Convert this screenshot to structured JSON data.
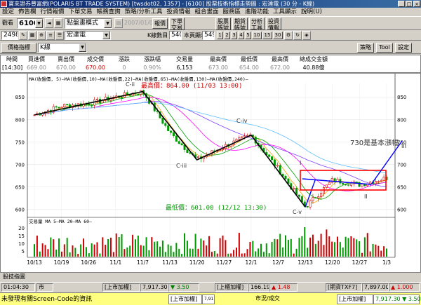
{
  "window": {
    "title": "寶來證券豐富網(POLARIS BT TRADE SYSTEM) [twsdot02, 1357] - [6100] 股票技術指標走勢圖 : 宏達電 (30 分 - K線)",
    "buttons": [
      "_",
      "□",
      "×"
    ]
  },
  "menu": [
    "設定",
    "佈告欄",
    "行情報價",
    "下單交易",
    "帳務查詢",
    "策略/分析工具",
    "投資情報",
    "組合畫面",
    "服務區",
    "進階功能",
    "工具顯示",
    "說明(U)"
  ],
  "toolbar1": {
    "view_label": "觀看",
    "stock_code": "6100",
    "mode_value": "點盤畫模式",
    "quote_button": "報價",
    "date_value": "2007/01/03",
    "k_count_label": "K線數目",
    "k_count": "540",
    "display_label": "本頁顯示",
    "display_count": "549",
    "order_button_1": "下單",
    "order_button_2": "交易",
    "service_button_1": "股票",
    "service_button_2": "帳號",
    "service_button_3": "期貨",
    "service_button_4": "帳號",
    "tool_button_1": "分析",
    "tool_button_2": "工具",
    "info_button_1": "投資",
    "info_button_2": "情報"
  },
  "toolbar2": {
    "code": "2498",
    "stock_name": "宏達電",
    "page_buttons": [
      "1",
      "2",
      "3",
      "4",
      "5",
      "10",
      "15",
      "30"
    ],
    "right_button_1": "策略",
    "right_button_2": "Tool",
    "right_button_3": "設定"
  },
  "toolbar3": {
    "indicator_button": "價格指標",
    "indicator_value": "K線"
  },
  "quote": {
    "headers": [
      "時間",
      "買進價",
      "賣出價",
      "成交價",
      "漲跌",
      "漲跌幅",
      "交易量",
      "最高價",
      "最低價",
      "最高價",
      "總成交金額"
    ],
    "values": [
      "[14:30]",
      "669.00",
      "670.00",
      "670.00",
      "0",
      "0.90%",
      "6,153",
      "673.00",
      "654.00",
      "672.00",
      "40.88億"
    ]
  },
  "chart": {
    "ma_legend": "MA(收盤價, 5)—MA(收盤價,10)—MA(收盤價,22)—MA(收盤價,65)—MA(收盤價,130)—MA(收盤價,240)—",
    "high_label": "最高價：864.00 (11/03 13:00)",
    "low_label": "最低價：601.00 (12/12 13:30)",
    "wave_labels": {
      "c_ii": "C-ii",
      "c_iii": "C-iii",
      "c_iv": "C-iv",
      "c_v": "C-v",
      "one": "I",
      "two": "II",
      "three": "III"
    },
    "annotation": "730是基本漲幅",
    "price_axis": [
      "850",
      "800",
      "750",
      "700",
      "650",
      "600"
    ],
    "volume_legend": "交易量 MA 5—MA 20—MA 60—",
    "volume_axis": [
      "20",
      "15",
      "10",
      "5"
    ],
    "date_axis": [
      "10/13",
      "10/19",
      "10/26",
      "11/1",
      "11/7",
      "11/13",
      "11/20",
      "11/27",
      "12/1",
      "12/7",
      "12/13",
      "12/20",
      "12/27",
      "1/3"
    ],
    "colors": {
      "up": "#cc0000",
      "down": "#009900",
      "ma5": "#ffa000",
      "ma10": "#00a000",
      "ma22": "#ff00ff",
      "ma65": "#8040ff",
      "ma130": "#60c0ff",
      "ma240": "#c0c0c0",
      "wave": "#000000",
      "box": "#ff0000",
      "trend": "#0000ff",
      "label_red": "#cc0000",
      "label_green": "#009900"
    }
  },
  "chart_data": {
    "type": "line",
    "title": "",
    "x": [
      "10/13",
      "10/19",
      "10/26",
      "11/1",
      "11/7",
      "11/13",
      "11/20",
      "11/27",
      "12/1",
      "12/7",
      "12/13",
      "12/20",
      "12/27",
      "1/3"
    ],
    "series": [
      {
        "name": "",
        "values": [
          810,
          830,
          835,
          850,
          862,
          770,
          710,
          740,
          765,
          690,
          605,
          665,
          655,
          670
        ]
      }
    ],
    "ylim": [
      590,
      880
    ]
  },
  "bottom": {
    "label": "股技指圖"
  },
  "status": {
    "time": "01:04:30",
    "market": "市",
    "index1_label": "[上市加權]",
    "index1_value": "7,917.30",
    "index1_change": "▼ 3.50",
    "index2_label": "[上櫃加權]",
    "index2_value": "166.19",
    "index2_change": "▲ 1.48",
    "index3_label": "[期貨TXF7]",
    "index3_value": "7,897.00",
    "index3_change": "▲ 1.000"
  },
  "ticker": {
    "message": "未發現有關Screen-Code的資訊",
    "b1": "[上市加權]",
    "b1v": "7,917.30 ▼ 3.50",
    "b2": "市況/成交",
    "b3": "[上市加權]",
    "b3v": "7,917.30 ▼ 3.50"
  }
}
